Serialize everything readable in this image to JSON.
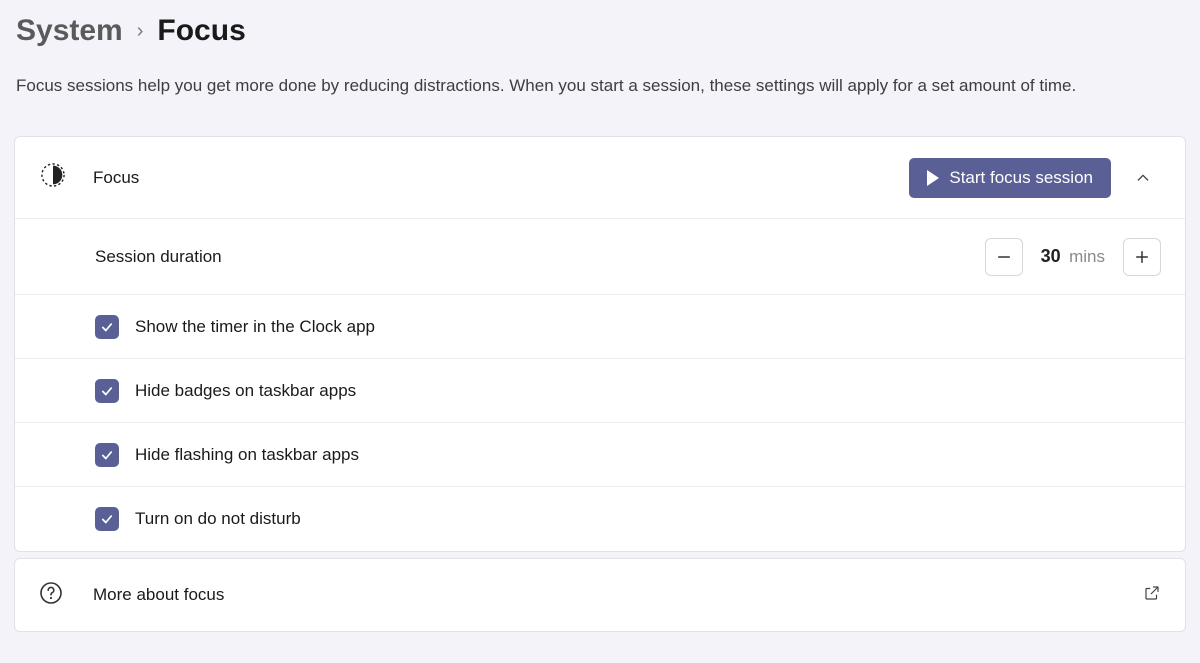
{
  "breadcrumb": {
    "parent": "System",
    "current": "Focus"
  },
  "description": "Focus sessions help you get more done by reducing distractions. When you start a session, these settings will apply for a set amount of time.",
  "focus": {
    "title": "Focus",
    "start_button": "Start focus session"
  },
  "duration": {
    "label": "Session duration",
    "value": "30",
    "unit": "mins"
  },
  "options": [
    {
      "label": "Show the timer in the Clock app",
      "checked": true
    },
    {
      "label": "Hide badges on taskbar apps",
      "checked": true
    },
    {
      "label": "Hide flashing on taskbar apps",
      "checked": true
    },
    {
      "label": "Turn on do not disturb",
      "checked": true
    }
  ],
  "more": {
    "label": "More about focus"
  }
}
